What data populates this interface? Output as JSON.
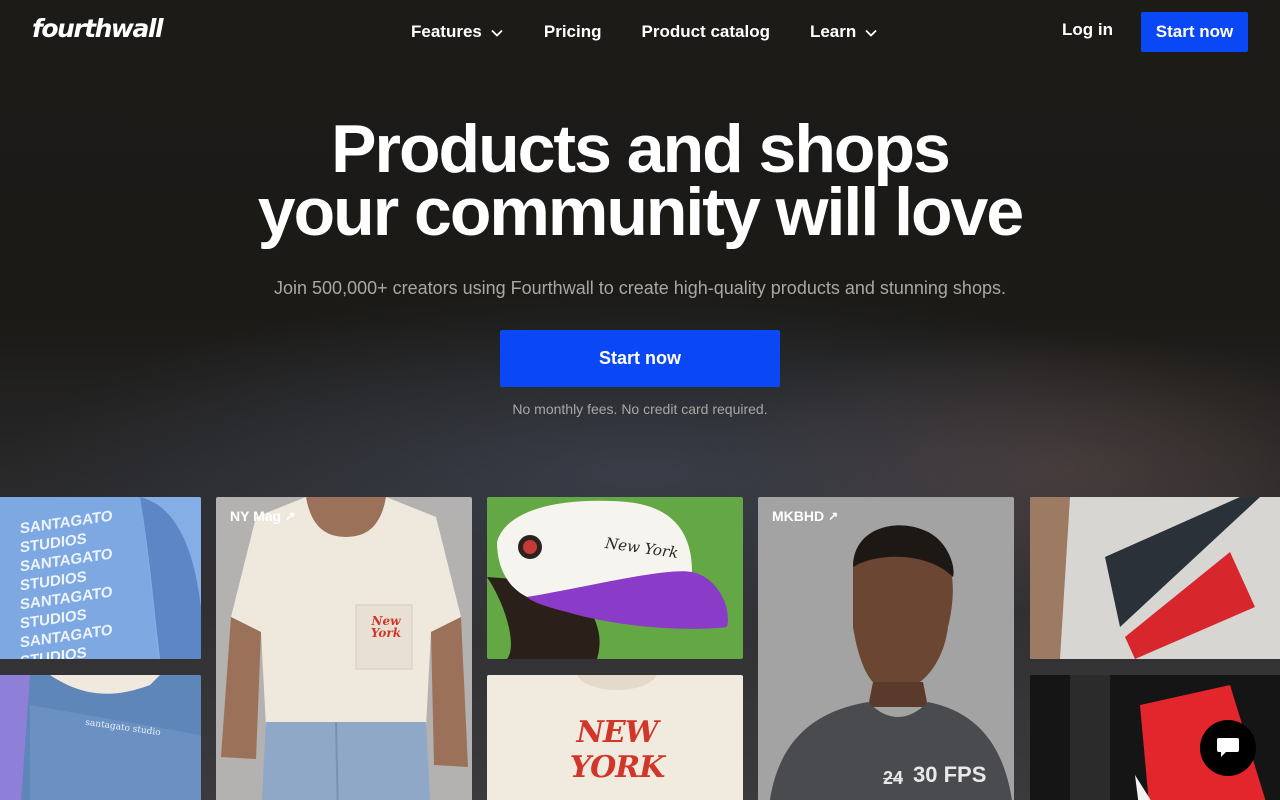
{
  "nav": {
    "logo": "fourthwall",
    "links": [
      {
        "label": "Features",
        "dropdown": true
      },
      {
        "label": "Pricing",
        "dropdown": false
      },
      {
        "label": "Product catalog",
        "dropdown": false
      },
      {
        "label": "Learn",
        "dropdown": true
      }
    ],
    "login": "Log in",
    "cta": "Start now"
  },
  "hero": {
    "title_line1": "Products and shops",
    "title_line2": "your community will love",
    "subtitle": "Join 500,000+ creators using Fourthwall to create high-quality products and stunning shops.",
    "cta": "Start now",
    "note": "No monthly fees. No credit card required."
  },
  "gallery": {
    "nymag_label": "NY Mag",
    "mkbhd_label": "MKBHD",
    "label_icon": "arrow-up-right-icon",
    "santagato_text": "SANTAGATO STUDIOS",
    "jacket_text": "santagato studio",
    "cap_text": "New York",
    "tee_text": "NEW YORK",
    "pocket_text": "New York",
    "shirt_text": "30 FPS",
    "shirt_strike": "24"
  },
  "chat": {
    "icon": "chat-bubble-icon"
  },
  "colors": {
    "accent": "#0a47f5",
    "background": "#1b1a17"
  }
}
